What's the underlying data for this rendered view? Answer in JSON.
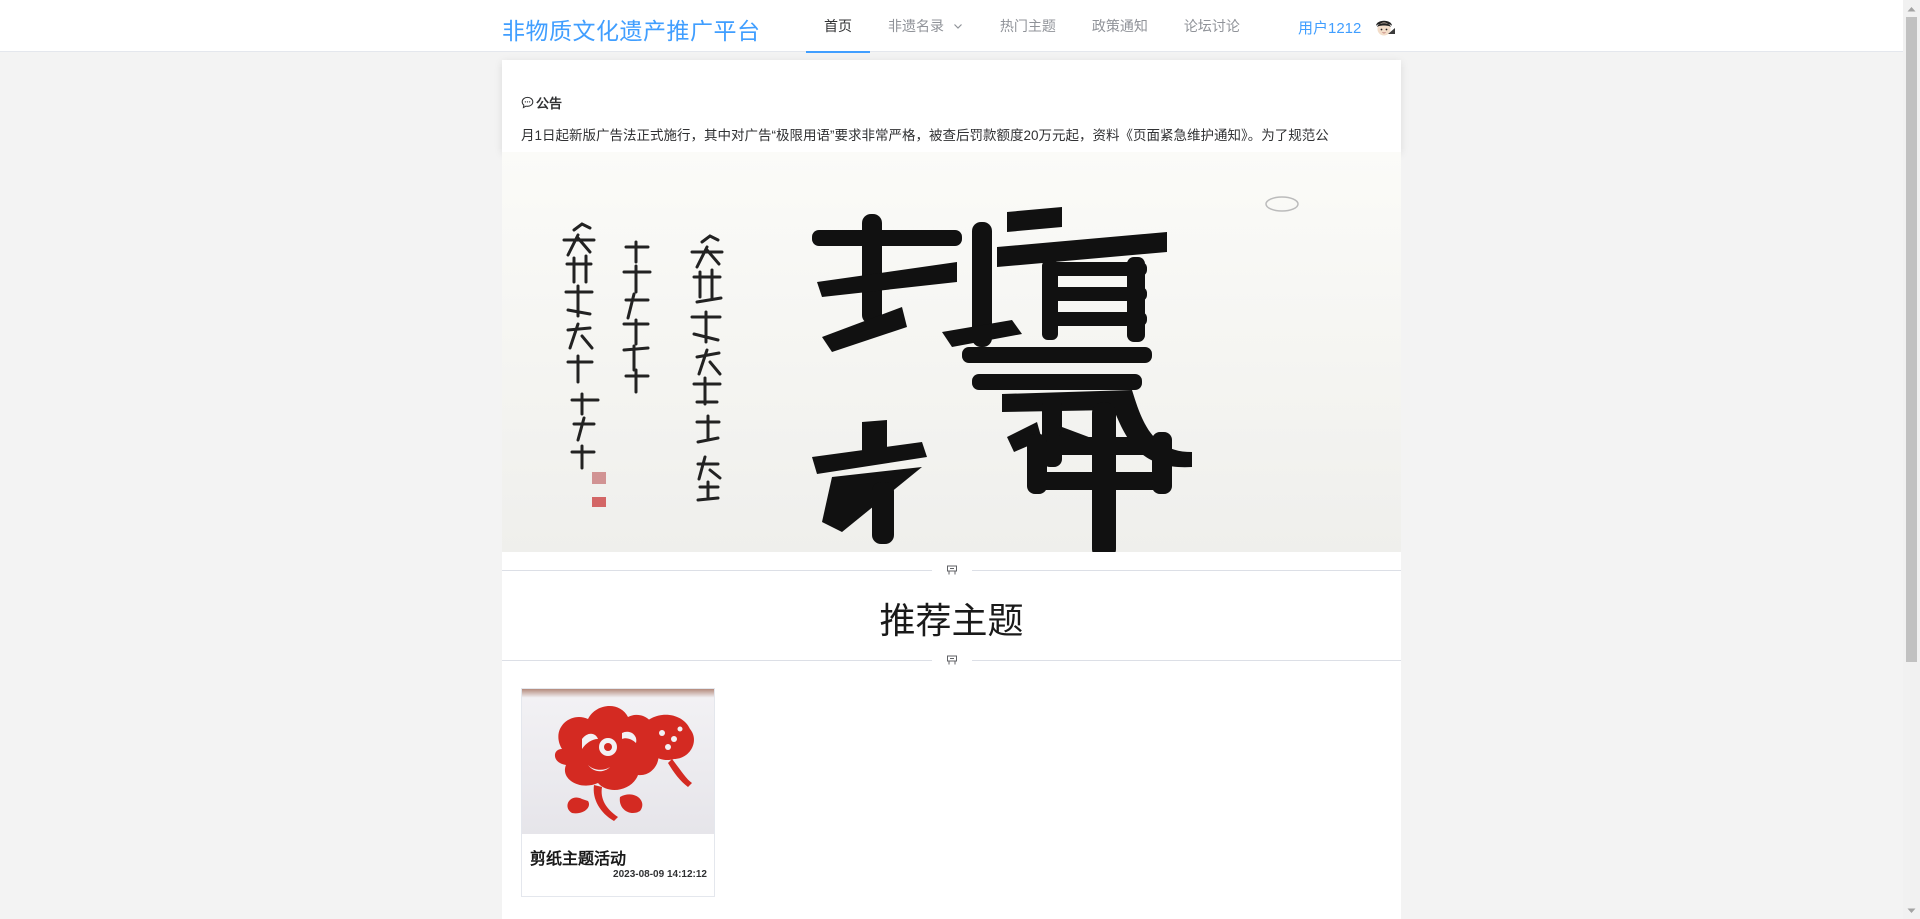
{
  "header": {
    "brand": "非物质文化遗产推广平台",
    "nav": [
      {
        "label": "首页",
        "active": true
      },
      {
        "label": "非遗名录",
        "has_dropdown": true
      },
      {
        "label": "热门主题"
      },
      {
        "label": "政策通知"
      },
      {
        "label": "论坛讨论"
      }
    ],
    "user_name": "用户1212"
  },
  "notice": {
    "title": "公告",
    "text": "月1日起新版广告法正式施行，其中对广告“极限用语”要求非常严格，被查后罚款额度20万元起，资料《页面紧急维护通知》。为了规范公"
  },
  "banner": {
    "image_alt": "calligraphy"
  },
  "section": {
    "title": "推荐主题"
  },
  "cards": [
    {
      "title": "剪纸主题活动",
      "date": "2023-08-09 14:12:12"
    }
  ],
  "colors": {
    "accent": "#409eff",
    "page_bg": "#f3f3f3",
    "paper_cut_red": "#d42a22"
  },
  "icons": {
    "notice": "chat-bubble-icon",
    "divider": "flag-icon",
    "nav_dropdown": "chevron-down-icon"
  }
}
